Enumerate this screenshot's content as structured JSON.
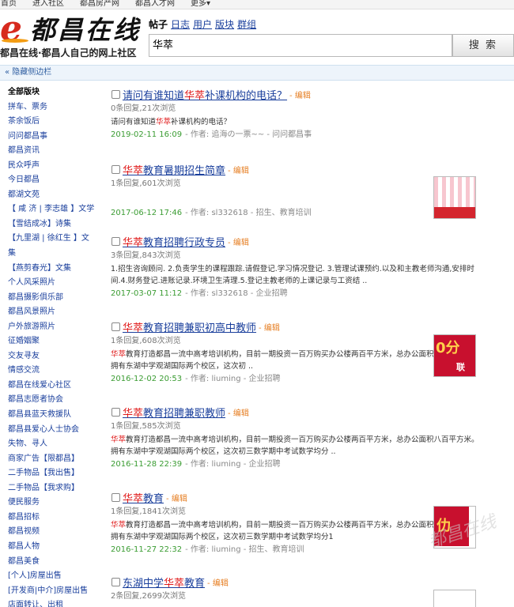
{
  "topnav": [
    "首页",
    "进入社区",
    "都昌房产网",
    "都昌人才网",
    "更多▾"
  ],
  "logo": {
    "mark": "e",
    "text": "都昌在线"
  },
  "slogan": "都昌在线·都昌人自己的网上社区",
  "search": {
    "tabs": {
      "current": "帖子",
      "links": [
        "日志",
        "用户",
        "版块",
        "群组"
      ]
    },
    "query": "华萃",
    "button": "搜 索"
  },
  "sidebar_toggle": "« 隐藏侧边栏",
  "sidebar": [
    "全部版块",
    "拼车、票务",
    "茶余饭后",
    "问问都昌事",
    "都昌资讯",
    "民众呼声",
    "今日都昌",
    "都湖文苑",
    "【 咸 济 | 李志雄 】文学",
    "【雪结成冰】诗集",
    "【九里湖 | 徐红生 】文集",
    "【燕剪春光】文集",
    "个人风采照片",
    "都昌摄影俱乐部",
    "都昌风景照片",
    "户外旅游照片",
    "征婚姻聚",
    "交友寻友",
    "情感交流",
    "都昌在线爱心社区",
    "都昌志愿者协会",
    "都昌县蓝天救援队",
    "都昌县爱心人士协会",
    "失物、寻人",
    "商家广告【限都昌】",
    "二手物品【我出售】",
    "二手物品【我求购】",
    "便民服务",
    "都昌招标",
    "都昌视频",
    "都昌人物",
    "都昌美食",
    "[个人]房屋出售",
    "[开发商|中介]房屋出售",
    "店面转让、出租"
  ],
  "posts": [
    {
      "pre": "请问有谁知道",
      "kw": "华萃",
      "post": "补课机构的电话？",
      "edit": "- 编辑",
      "stats": "0条回复,21次浏览",
      "excerpt": {
        "pre": "请问有谁知道",
        "kw": "华萃",
        "post": "补课机构的电话？"
      },
      "date": "2019-02-11 16:09",
      "meta": "- 作者: 追海の一票~~ - 问问都昌事"
    },
    {
      "pre": "",
      "kw": "华萃",
      "post": "教育暑期招生简章",
      "edit": "- 编辑",
      "stats": "1条回复,601次浏览",
      "excerpt": null,
      "date": "2017-06-12 17:46",
      "meta": "- 作者: sl332618 - 招生、教育培训"
    },
    {
      "pre": "",
      "kw": "华萃",
      "post": "教育招聘行政专员",
      "edit": "- 编辑",
      "stats": "3条回复,843次浏览",
      "excerpt": {
        "pre": "1.招生咨询顾问. 2.负责学生的课程跟踪.请假登记.学习情况登记. 3.管理试课预约.以及和主教老师沟通,安排时间.4.财务登记.进账记录.环境卫生清理.5.登记主教老师的上课记录与工资结 ..",
        "kw": "",
        "post": ""
      },
      "date": "2017-03-07 11:12",
      "meta": "- 作者: sl332618 - 企业招聘"
    },
    {
      "pre": "",
      "kw": "华萃",
      "post": "教育招聘兼职初高中教师",
      "edit": "- 编辑",
      "stats": "1条回复,608次浏览",
      "excerpt": {
        "pre": "",
        "kw": "华萃",
        "post": "教育打造都昌一流中高考培训机构，目前一期投资一百万购买办公楼两百平方米，总办公面积八百平方米。拥有东湖中学观湖国际两个校区，这次初 .."
      },
      "date": "2016-12-02 20:53",
      "meta": "- 作者: liuming - 企业招聘"
    },
    {
      "pre": "",
      "kw": "华萃",
      "post": "教育招聘兼职教师",
      "edit": "- 编辑",
      "stats": "1条回复,585次浏览",
      "excerpt": {
        "pre": "",
        "kw": "华萃",
        "post": "教育打造都昌一流中高考培训机构，目前一期投资一百万购买办公楼两百平方米，总办公面积八百平方米。拥有东湖中学观湖国际两个校区，这次初三数学期中考试数学均分 .."
      },
      "date": "2016-11-28 22:39",
      "meta": "- 作者: liuming - 企业招聘"
    },
    {
      "pre": "",
      "kw": "华萃",
      "post": "教育",
      "edit": "- 编辑",
      "stats": "1条回复,1841次浏览",
      "excerpt": {
        "pre": "",
        "kw": "华萃",
        "post": "教育打造都昌一流中高考培训机构，目前一期投资一百万购买办公楼两百平方米，总办公面积八百平方米。拥有东湖中学观湖国际两个校区，这次初三数学期中考试数学均分1"
      },
      "date": "2016-11-27 22:32",
      "meta": "- 作者: liuming - 招生、教育培训"
    },
    {
      "pre": "东湖中学",
      "kw": "华萃",
      "post": "教育",
      "edit": "- 编辑",
      "stats": "2条回复,2699次浏览",
      "excerpt": null,
      "date": "",
      "meta": ""
    }
  ],
  "thumbs": {
    "t2": "0分",
    "t2sub": "联",
    "t3": "仂"
  },
  "watermark": "都昌在线"
}
